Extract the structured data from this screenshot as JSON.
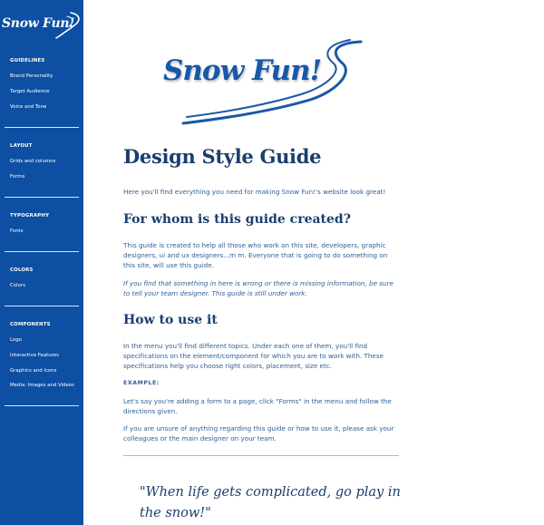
{
  "brand": {
    "sidebar_logo_text": "Snow Fun!",
    "hero_logo_text": "Snow Fun!",
    "colors": {
      "sidebar_bg": "#0d4fa3",
      "heading": "#1a3e6e",
      "body_text": "#2e5f96",
      "logo_blue": "#1957a8"
    }
  },
  "sidebar": {
    "sections": [
      {
        "heading": "GUIDELINES",
        "items": [
          "Brand Personality",
          "Target Audience",
          "Voice and Tone"
        ]
      },
      {
        "heading": "LAYOUT",
        "items": [
          "Grids and columns",
          "Forms"
        ]
      },
      {
        "heading": "TYPOGRAPHY",
        "items": [
          "Fonts"
        ]
      },
      {
        "heading": "COLORS",
        "items": [
          "Colors"
        ]
      },
      {
        "heading": "COMPONENTS",
        "items": [
          "Logo",
          "Interactive Features",
          "Graphics and Icons",
          "Media: Images and Videos"
        ]
      }
    ]
  },
  "main": {
    "title": "Design Style Guide",
    "intro": "Here you'll find everything you need for making Snow Fun!'s website look great!",
    "section1": {
      "heading": "For whom is this guide created?",
      "para": "This guide is created to help all those who work on this site, developers, graphic designers, ui and ux designers...m m. Everyone that is going to do something on this site, will use this guide.",
      "note": "If you find that something in here is wrong or there is missing information, be sure to tell your team designer. This guide is still under work."
    },
    "section2": {
      "heading": "How to use it",
      "para": "In the menu you'll find different topics. Under each one of them, you'll find specifications on the element/component for which you are to work with. These specifications help you choose right colors, placement, size etc.",
      "example_label": "EXAMPLE:",
      "example": "Let's say you're adding a form to a page, click \"Forms\" in the menu and follow the directions given.",
      "contact": "If you are unsure of anything regarding this guide or how to use it, please ask your colleagues or the main designer on your team."
    },
    "quote": "\"When life gets complicated, go play in the snow!\""
  }
}
